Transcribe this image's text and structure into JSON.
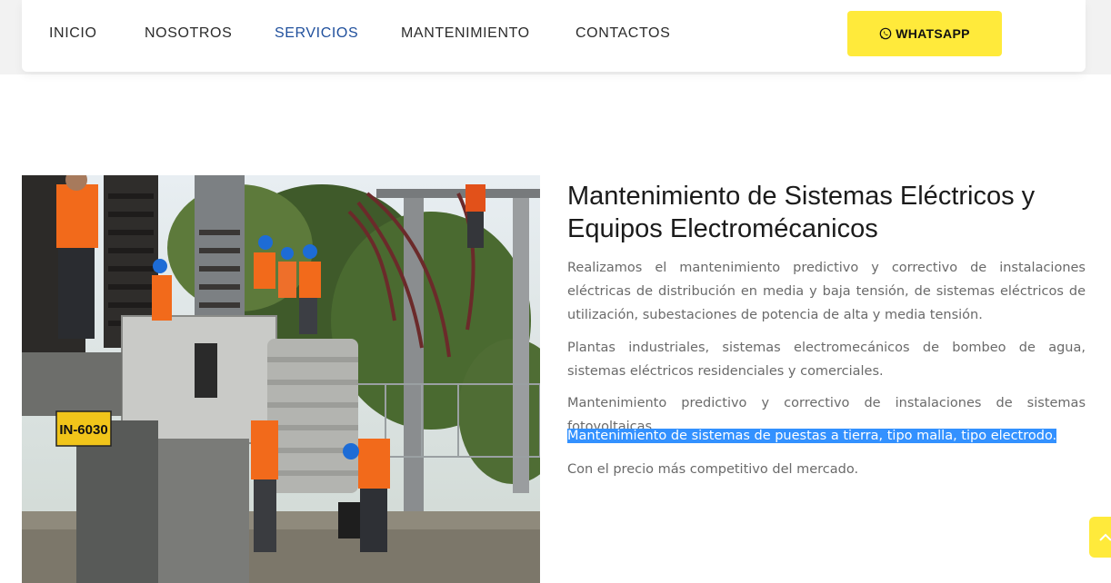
{
  "nav": {
    "items": [
      {
        "label": "INICIO",
        "active": false
      },
      {
        "label": "NOSOTROS",
        "active": false
      },
      {
        "label": "SERVICIOS",
        "active": true
      },
      {
        "label": "MANTENIMIENTO",
        "active": false
      },
      {
        "label": "CONTACTOS",
        "active": false
      }
    ],
    "whatsapp_label": "WHATSAPP",
    "whatsapp_icon": "whatsapp-icon"
  },
  "photo": {
    "tag_label": "IN-6030"
  },
  "content": {
    "heading": "Mantenimiento de Sistemas Eléctricos y Equipos Electromécanicos",
    "paragraphs": [
      "Realizamos el mantenimiento predictivo y correctivo de instalaciones eléctricas de distribución en media y baja tensión, de sistemas eléctricos de utilización, subestaciones de potencia de alta y media tensión.",
      "Plantas industriales, sistemas electromecánicos de bombeo de agua, sistemas eléctricos residenciales y comerciales.",
      "Mantenimiento predictivo y correctivo de instalaciones de sistemas fotovoltaicas.",
      "Mantenimiento de sistemas de puestas a tierra, tipo malla, tipo electrodo.",
      "Con el precio más competitivo del mercado."
    ]
  },
  "colors": {
    "accent_yellow": "#ffea3b",
    "active_nav": "#1f4f9c",
    "selection": "#3391ff"
  }
}
